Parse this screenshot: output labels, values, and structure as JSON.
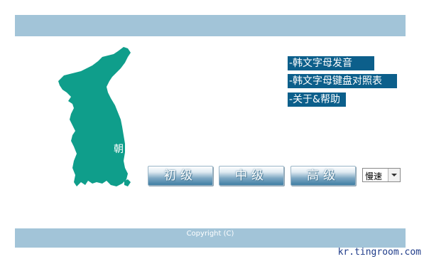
{
  "menu": {
    "items": [
      {
        "label": "-韩文字母发音"
      },
      {
        "label": "-韩文字母键盘对照表"
      },
      {
        "label": "-关于&帮助"
      }
    ]
  },
  "levels": {
    "beginner": "初级",
    "intermediate": "中级",
    "advanced": "高级"
  },
  "speed": {
    "selected": "慢速"
  },
  "map": {
    "label": "朝",
    "color": "#0f9e8b"
  },
  "footer": {
    "copyright": "Copyright (C)",
    "url": "kr.tingroom.com"
  },
  "colors": {
    "band": "#a2c4d8",
    "menu_bg": "#0c5f8b"
  }
}
